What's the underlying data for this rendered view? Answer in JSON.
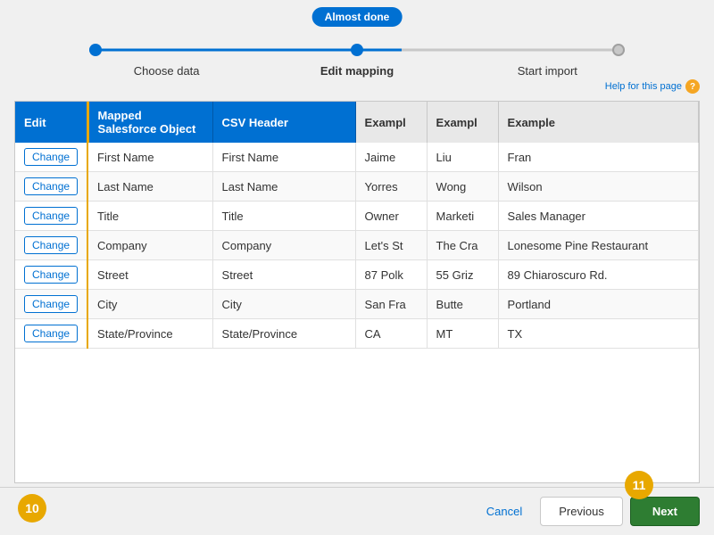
{
  "progress": {
    "badge": "Almost done",
    "steps": [
      {
        "id": "step1",
        "label": "Choose data",
        "active": false
      },
      {
        "id": "step2",
        "label": "Edit mapping",
        "active": true
      },
      {
        "id": "step3",
        "label": "Start import",
        "active": false
      }
    ]
  },
  "help_link": "Help for this page",
  "table": {
    "headers": {
      "edit": "Edit",
      "mapped": "Mapped Salesforce Object",
      "csv": "CSV Header",
      "ex1": "Exampl",
      "ex2": "Exampl",
      "ex3": "Example"
    },
    "rows": [
      {
        "mapped": "First Name",
        "csv": "First Name",
        "ex1": "Jaime",
        "ex2": "Liu",
        "ex3": "Fran"
      },
      {
        "mapped": "Last Name",
        "csv": "Last Name",
        "ex1": "Yorres",
        "ex2": "Wong",
        "ex3": "Wilson"
      },
      {
        "mapped": "Title",
        "csv": "Title",
        "ex1": "Owner",
        "ex2": "Marketi",
        "ex3": "Sales Manager"
      },
      {
        "mapped": "Company",
        "csv": "Company",
        "ex1": "Let's St",
        "ex2": "The Cra",
        "ex3": "Lonesome Pine Restaurant"
      },
      {
        "mapped": "Street",
        "csv": "Street",
        "ex1": "87 Polk",
        "ex2": "55 Griz",
        "ex3": "89 Chiaroscuro Rd."
      },
      {
        "mapped": "City",
        "csv": "City",
        "ex1": "San Fra",
        "ex2": "Butte",
        "ex3": "Portland"
      },
      {
        "mapped": "State/Province",
        "csv": "State/Province",
        "ex1": "CA",
        "ex2": "MT",
        "ex3": "TX"
      }
    ],
    "change_label": "Change"
  },
  "buttons": {
    "cancel": "Cancel",
    "previous": "Previous",
    "next": "Next"
  },
  "badges": {
    "ten": "10",
    "eleven": "11"
  }
}
